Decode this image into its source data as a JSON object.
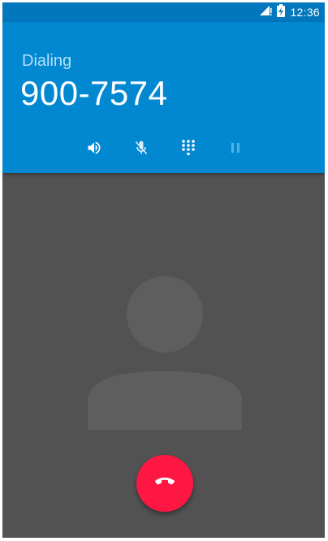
{
  "status_bar": {
    "time": "12:36",
    "icons": [
      "signal-icon",
      "battery-charging-icon"
    ]
  },
  "call": {
    "state": "Dialing",
    "number": "900-7574"
  },
  "controls": [
    {
      "name": "speaker-button",
      "icon": "speaker-icon"
    },
    {
      "name": "mute-button",
      "icon": "mic-off-icon"
    },
    {
      "name": "dialpad-button",
      "icon": "dialpad-icon"
    },
    {
      "name": "hold-button",
      "icon": "pause-icon"
    }
  ],
  "colors": {
    "header": "#0288d1",
    "status_bar": "#0277bd",
    "background": "#525252",
    "avatar": "#5e5e5e",
    "end_call": "#ff1744"
  },
  "end_call": {
    "icon": "end-call-icon"
  }
}
